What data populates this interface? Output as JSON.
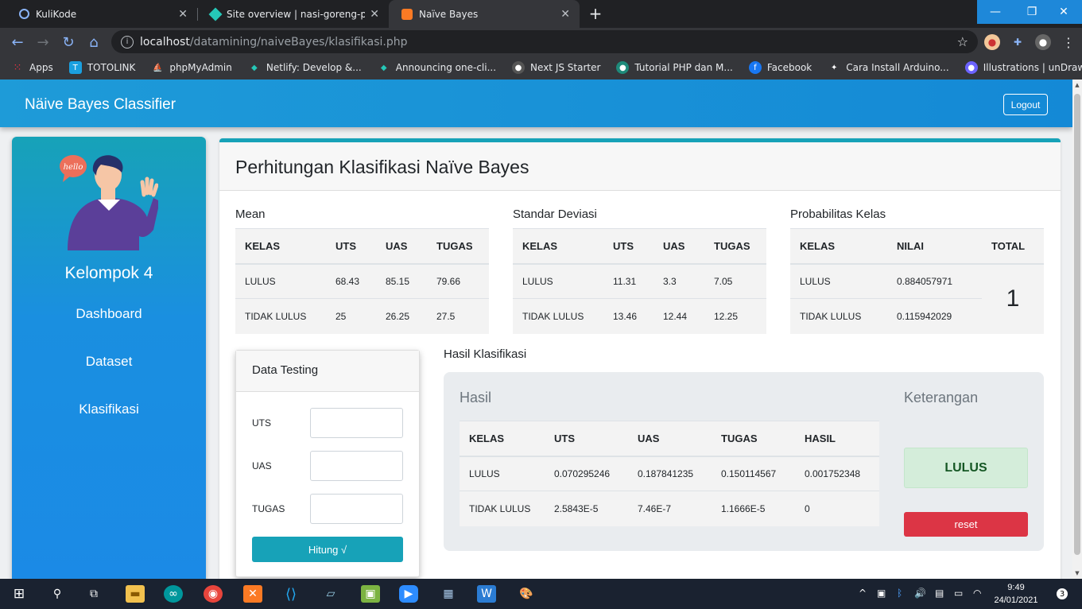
{
  "browser": {
    "tabs": [
      {
        "title": "KuliKode",
        "icon": "globe-icon",
        "active": false
      },
      {
        "title": "Site overview | nasi-goreng-pahla",
        "icon": "netlify-icon",
        "active": false
      },
      {
        "title": "Naïve Bayes",
        "icon": "xampp-icon",
        "active": true
      }
    ],
    "url_host": "localhost",
    "url_path": "/datamining/naiveBayes/klasifikasi.php",
    "bookmarks": [
      "Apps",
      "TOTOLINK",
      "phpMyAdmin",
      "Netlify: Develop &...",
      "Announcing one-cli...",
      "Next JS Starter",
      "Tutorial PHP dan M...",
      "Facebook",
      "Cara Install Arduino...",
      "Illustrations | unDraw"
    ]
  },
  "navbar": {
    "brand": "Näive Bayes Classifier",
    "logout_label": "Logout"
  },
  "sidebar": {
    "group_name": "Kelompok 4",
    "avatar_bubble": "hello",
    "links": [
      "Dashboard",
      "Dataset",
      "Klasifikasi"
    ]
  },
  "main": {
    "title": "Perhitungan Klasifikasi Naïve Bayes",
    "mean": {
      "title": "Mean",
      "headers": [
        "KELAS",
        "UTS",
        "UAS",
        "TUGAS"
      ],
      "rows": [
        [
          "LULUS",
          "68.43",
          "85.15",
          "79.66"
        ],
        [
          "TIDAK LULUS",
          "25",
          "26.25",
          "27.5"
        ]
      ]
    },
    "std": {
      "title": "Standar Deviasi",
      "headers": [
        "KELAS",
        "UTS",
        "UAS",
        "TUGAS"
      ],
      "rows": [
        [
          "LULUS",
          "11.31",
          "3.3",
          "7.05"
        ],
        [
          "TIDAK LULUS",
          "13.46",
          "12.44",
          "12.25"
        ]
      ]
    },
    "prob": {
      "title": "Probabilitas Kelas",
      "headers": [
        "KELAS",
        "NILAI",
        "TOTAL"
      ],
      "rows": [
        [
          "LULUS",
          "0.884057971"
        ],
        [
          "TIDAK LULUS",
          "0.115942029"
        ]
      ],
      "total": "1"
    },
    "testing": {
      "title": "Data Testing",
      "fields": [
        {
          "label": "UTS",
          "value": ""
        },
        {
          "label": "UAS",
          "value": ""
        },
        {
          "label": "TUGAS",
          "value": ""
        }
      ],
      "submit_label": "Hitung √"
    },
    "hasil": {
      "section_title": "Hasil Klasifikasi",
      "hasil_label": "Hasil",
      "keterangan_label": "Keterangan",
      "headers": [
        "KELAS",
        "UTS",
        "UAS",
        "TUGAS",
        "HASIL"
      ],
      "rows": [
        [
          "LULUS",
          "0.070295246",
          "0.187841235",
          "0.150114567",
          "0.001752348"
        ],
        [
          "TIDAK LULUS",
          "2.5843E-5",
          "7.46E-7",
          "1.1666E-5",
          "0"
        ]
      ],
      "result": "LULUS",
      "reset_label": "reset"
    }
  },
  "taskbar": {
    "time": "9:49",
    "date": "24/01/2021",
    "notifications": "3"
  }
}
